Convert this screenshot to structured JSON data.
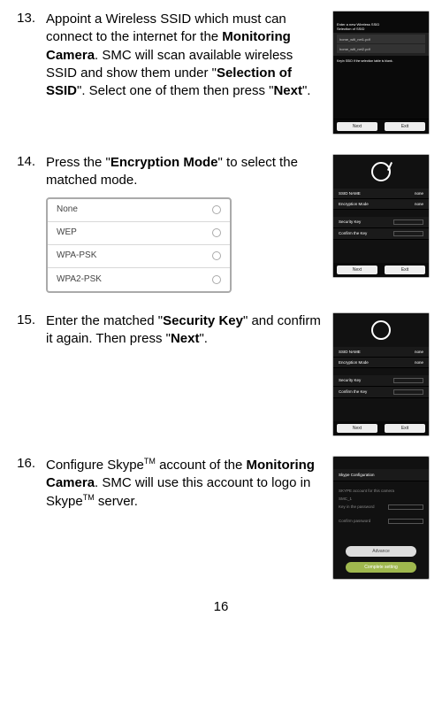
{
  "steps": [
    {
      "num": "13.",
      "parts": [
        "Appoint a Wireless SSID which must can connect to the internet for the ",
        "Monitoring Camera",
        ". SMC will scan available wireless SSID and show them under \"",
        "Selection of SSID",
        "\".   Select one of them then press \"",
        "Next",
        "\"."
      ]
    },
    {
      "num": "14.",
      "parts": [
        "Press the \"",
        "Encryption Mode",
        "\" to select the matched mode."
      ]
    },
    {
      "num": "15.",
      "parts": [
        "Enter the matched \"",
        "Security Key",
        "\" and confirm it again. Then press \"",
        "Next",
        "\"."
      ]
    },
    {
      "num": "16.",
      "parts_pre": "Configure Skype",
      "parts_mid": " account of the ",
      "parts_bold": "Monitoring Camera",
      "parts_mid2": ".   SMC will use this account to logo in Skype",
      "parts_end": " server."
    }
  ],
  "dropdown_options": [
    "None",
    "WEP",
    "WPA-PSK",
    "WPA2-PSK"
  ],
  "ss13": {
    "title1": "Enter a new Wireless SSID",
    "title2": "Selection of SSID",
    "ssids": [
      "home_wifi_net1.pdf",
      "home_wifi_net2.pdf"
    ],
    "hint": "Keyin SSID if the selection table is blank.",
    "btn_next": "Next",
    "btn_exit": "Exit"
  },
  "ss14": {
    "l1": "SSID NAME",
    "l1v": "none",
    "l2": "Encryption Mode",
    "l2v": "none",
    "l3": "Security Key",
    "l4": "Confirm the Key",
    "btn_next": "Next",
    "btn_exit": "Exit"
  },
  "ss15": {
    "l1": "SSID NAME",
    "l1v": "none",
    "l2": "Encryption Mode",
    "l2v": "none",
    "l3": "Security Key",
    "l4": "Confirm the Key",
    "btn_next": "Next",
    "btn_exit": "Exit"
  },
  "ss16": {
    "title": "Skype Configuration",
    "l1": "SKYPE account for this camera",
    "l1v": "SMC_1",
    "l2": "Key in the password",
    "l3": "Confirm password",
    "btn_adv": "Advance",
    "btn_complete": "Complete setting"
  },
  "page_number": "16",
  "tm": "TM"
}
